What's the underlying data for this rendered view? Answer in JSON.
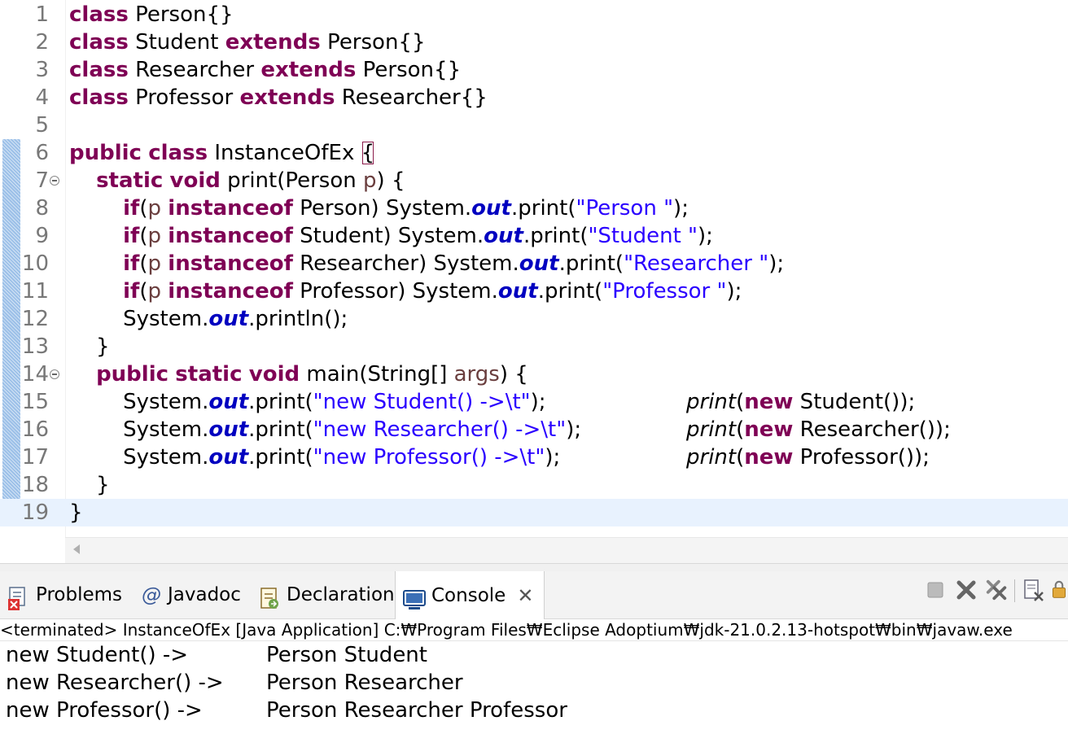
{
  "editor": {
    "lines": [
      {
        "n": "1",
        "html": "<span class=\"kw\">class</span> Person{}"
      },
      {
        "n": "2",
        "html": "<span class=\"kw\">class</span> Student <span class=\"kw\">extends</span> Person{}"
      },
      {
        "n": "3",
        "html": "<span class=\"kw\">class</span> Researcher <span class=\"kw\">extends</span> Person{}"
      },
      {
        "n": "4",
        "html": "<span class=\"kw\">class</span> Professor <span class=\"kw\">extends</span> Researcher{}"
      },
      {
        "n": "5",
        "html": ""
      },
      {
        "n": "6",
        "html": "<span class=\"kw\">public</span> <span class=\"kw\">class</span> InstanceOfEx <span class=\"brace\">{</span>"
      },
      {
        "n": "7",
        "fold": true,
        "html": "    <span class=\"kw\">static</span> <span class=\"kw\">void</span> print(Person <span class=\"par\">p</span>) {"
      },
      {
        "n": "8",
        "html": "        <span class=\"kw\">if</span>(<span class=\"par\">p</span> <span class=\"kw\">instanceof</span> Person) System.<span class=\"fld\">out</span>.print(<span class=\"str\">\"Person \"</span>);"
      },
      {
        "n": "9",
        "html": "        <span class=\"kw\">if</span>(<span class=\"par\">p</span> <span class=\"kw\">instanceof</span> Student) System.<span class=\"fld\">out</span>.print(<span class=\"str\">\"Student \"</span>);"
      },
      {
        "n": "10",
        "html": "        <span class=\"kw\">if</span>(<span class=\"par\">p</span> <span class=\"kw\">instanceof</span> Researcher) System.<span class=\"fld\">out</span>.print(<span class=\"str\">\"Researcher \"</span>);"
      },
      {
        "n": "11",
        "html": "        <span class=\"kw\">if</span>(<span class=\"par\">p</span> <span class=\"kw\">instanceof</span> Professor) System.<span class=\"fld\">out</span>.print(<span class=\"str\">\"Professor \"</span>);"
      },
      {
        "n": "12",
        "html": "        System.<span class=\"fld\">out</span>.println();"
      },
      {
        "n": "13",
        "html": "    }"
      },
      {
        "n": "14",
        "fold": true,
        "html": "    <span class=\"kw\">public</span> <span class=\"kw\">static</span> <span class=\"kw\">void</span> main(String[] <span class=\"par\">args</span>) {"
      },
      {
        "n": "15",
        "html": "        System.<span class=\"fld\">out</span>.print(<span class=\"str\">\"new Student() -&gt;\\t\"</span>);",
        "html2": "<span class=\"sta\">print</span>(<span class=\"kw\">new</span> Student());"
      },
      {
        "n": "16",
        "html": "        System.<span class=\"fld\">out</span>.print(<span class=\"str\">\"new Researcher() -&gt;\\t\"</span>);",
        "html2": "<span class=\"sta\">print</span>(<span class=\"kw\">new</span> Researcher());"
      },
      {
        "n": "17",
        "html": "        System.<span class=\"fld\">out</span>.print(<span class=\"str\">\"new Professor() -&gt;\\t\"</span>);",
        "html2": "<span class=\"sta\">print</span>(<span class=\"kw\">new</span> Professor());"
      },
      {
        "n": "18",
        "html": "    }"
      },
      {
        "n": "19",
        "current": true,
        "html": "}"
      }
    ]
  },
  "tabs": {
    "problems": "Problems",
    "javadoc": "Javadoc",
    "declaration": "Declaration",
    "console": "Console",
    "close": "✕"
  },
  "console": {
    "header": "<terminated> InstanceOfEx [Java Application] C:₩Program Files₩Eclipse Adoptium₩jdk-21.0.2.13-hotspot₩bin₩javaw.exe",
    "output": [
      {
        "left": "new Student() ->",
        "right": "Person Student"
      },
      {
        "left": "new Researcher() ->",
        "right": "Person Researcher"
      },
      {
        "left": "new Professor() ->",
        "right": "Person Researcher Professor"
      }
    ]
  },
  "colors": {
    "keyword": "#7f0055",
    "string": "#2a00ff",
    "field": "#0000c0",
    "current_line": "#e8f2fe"
  }
}
